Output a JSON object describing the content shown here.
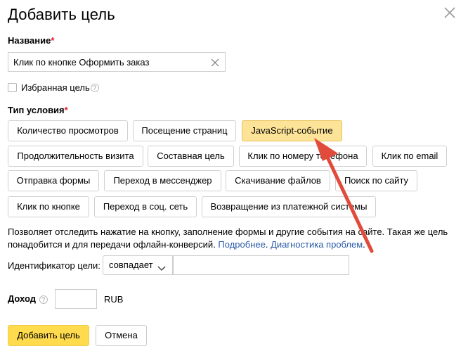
{
  "dialog": {
    "title": "Добавить цель"
  },
  "name_field": {
    "label": "Название",
    "required_mark": "*",
    "value": "Клик по кнопке Оформить заказ"
  },
  "favorite": {
    "label": "Избранная цель",
    "help": "?",
    "checked": false
  },
  "condition": {
    "label": "Тип условия",
    "required_mark": "*",
    "types": [
      {
        "label": "Количество просмотров",
        "active": false
      },
      {
        "label": "Посещение страниц",
        "active": false
      },
      {
        "label": "JavaScript-событие",
        "active": true
      },
      {
        "label": "Продолжительность визита",
        "active": false
      },
      {
        "label": "Составная цель",
        "active": false
      },
      {
        "label": "Клик по номеру телефона",
        "active": false
      },
      {
        "label": "Клик по email",
        "active": false
      },
      {
        "label": "Отправка формы",
        "active": false
      },
      {
        "label": "Переход в мессенджер",
        "active": false
      },
      {
        "label": "Скачивание файлов",
        "active": false
      },
      {
        "label": "Поиск по сайту",
        "active": false
      },
      {
        "label": "Клик по кнопке",
        "active": false
      },
      {
        "label": "Переход в соц. сеть",
        "active": false
      },
      {
        "label": "Возвращение из платежной системы",
        "active": false
      }
    ]
  },
  "description": {
    "text": "Позволяет отследить нажатие на кнопку, заполнение формы и другие события на сайте. Такая же цель понадобится и для передачи офлайн-конверсий. ",
    "link_more": "Подробнее",
    "separator": ". ",
    "link_diag": "Диагностика проблем",
    "end": "."
  },
  "identifier": {
    "label": "Идентификатор цели:",
    "match_selected": "совпадает",
    "value": ""
  },
  "income": {
    "label": "Доход",
    "help": "?",
    "value": "",
    "currency": "RUB"
  },
  "actions": {
    "add_label": "Добавить цель",
    "cancel_label": "Отмена"
  },
  "colors": {
    "active_chip": "#fde398",
    "primary_button": "#ffdb4d",
    "required": "#e4192b",
    "link": "#2a5ba8",
    "arrow": "#e14b3b"
  }
}
